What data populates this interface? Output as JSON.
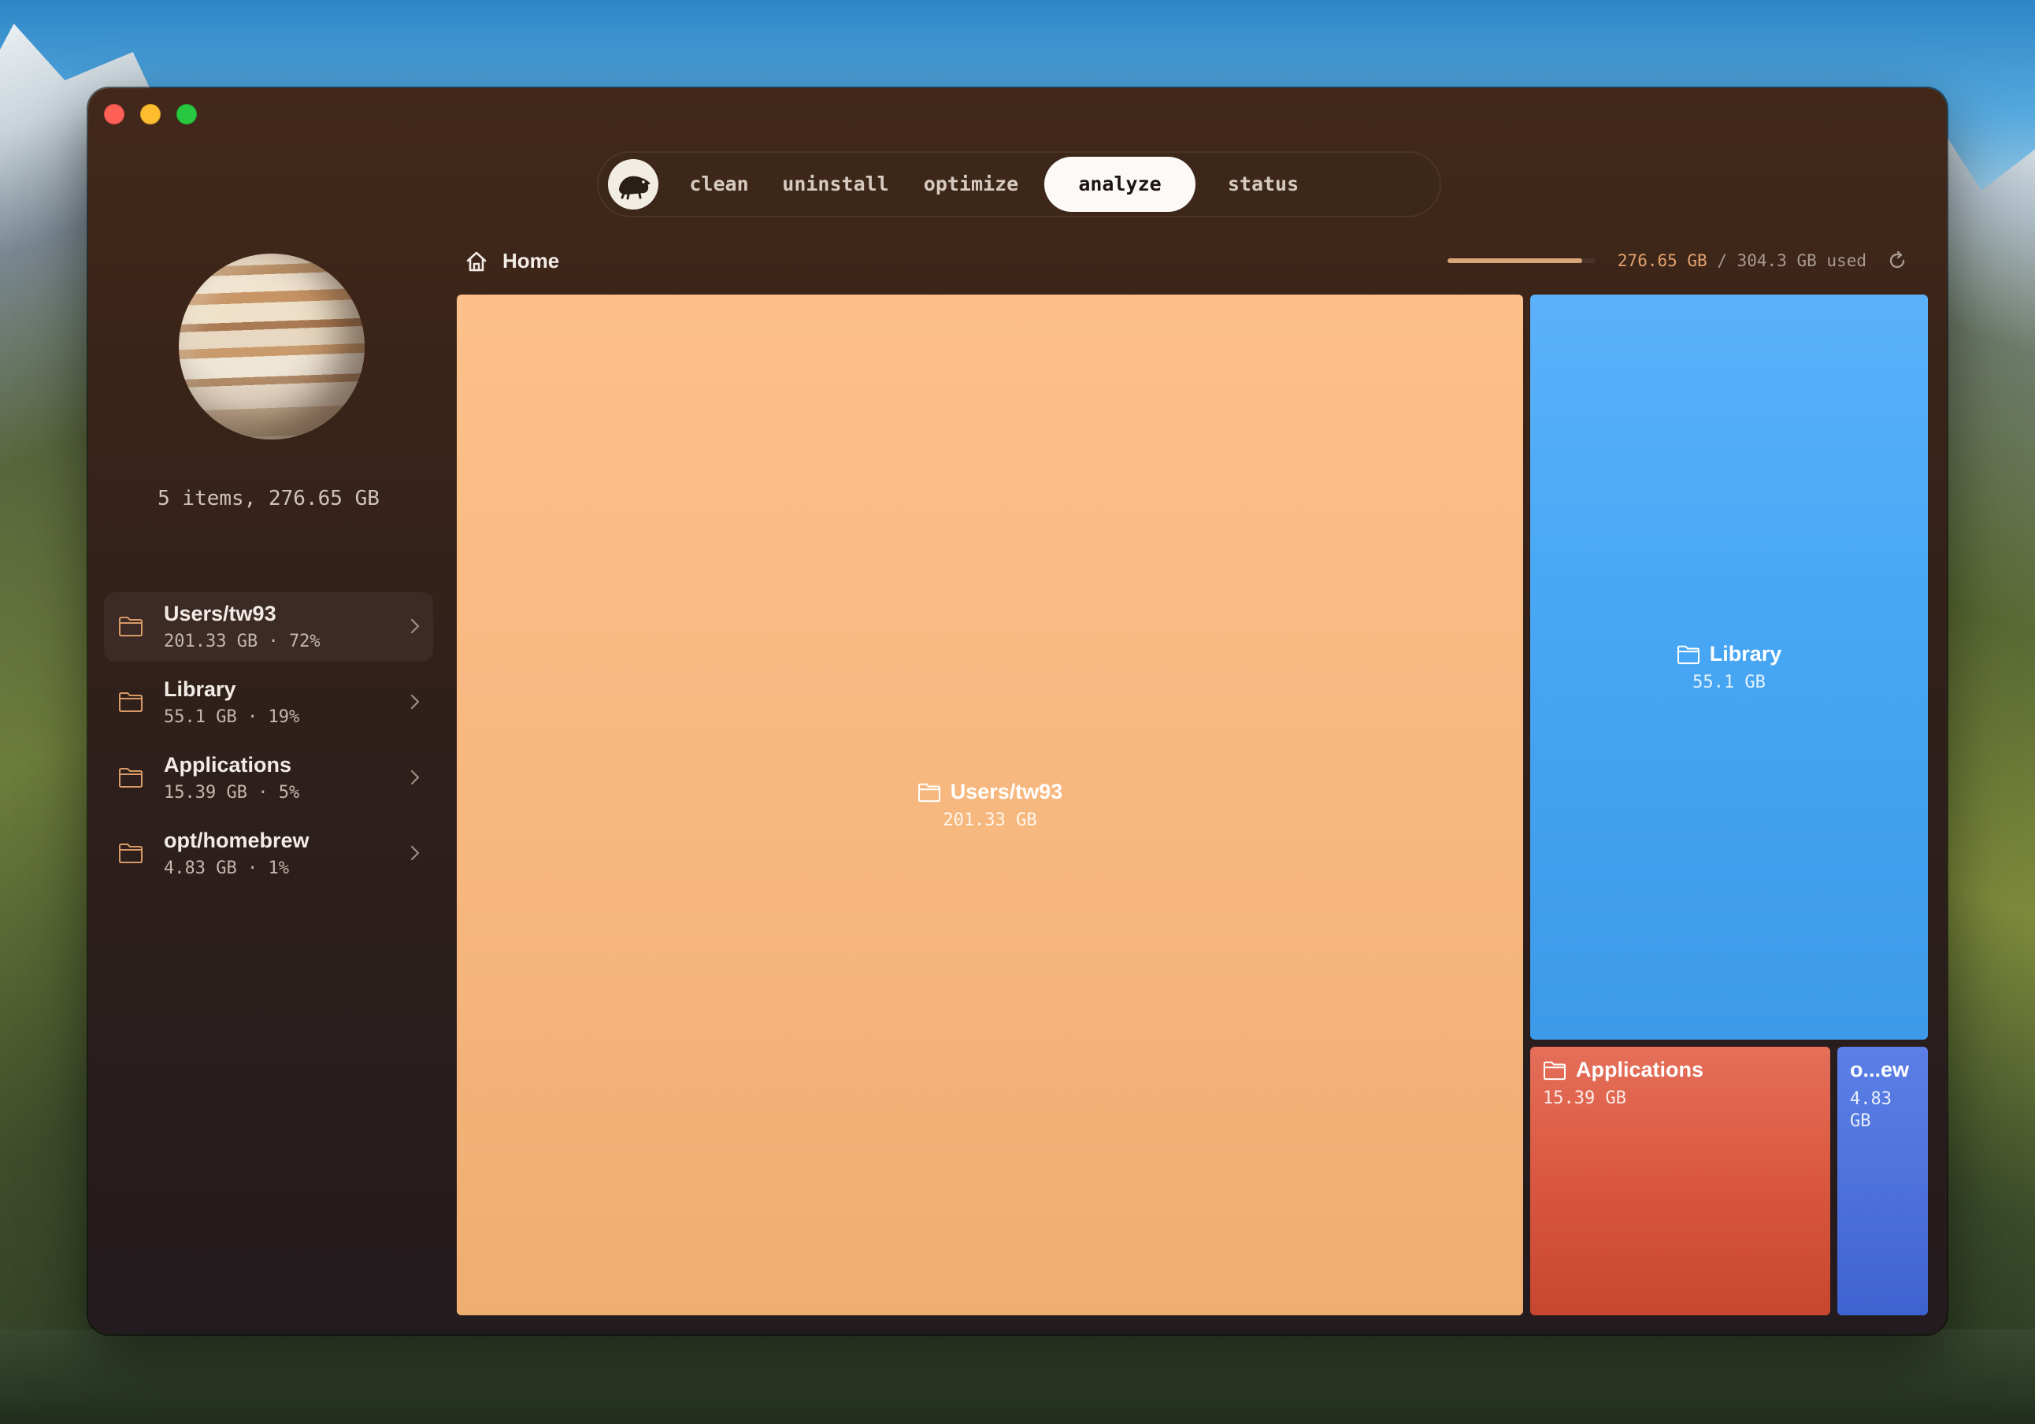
{
  "nav": {
    "tabs": [
      {
        "label": "clean",
        "active": false
      },
      {
        "label": "uninstall",
        "active": false
      },
      {
        "label": "optimize",
        "active": false
      },
      {
        "label": "analyze",
        "active": true
      },
      {
        "label": "status",
        "active": false
      }
    ]
  },
  "sidebar": {
    "summary": "5 items, 276.65 GB",
    "items": [
      {
        "name": "Users/tw93",
        "meta": "201.33 GB · 72%",
        "selected": true
      },
      {
        "name": "Library",
        "meta": "55.1 GB · 19%",
        "selected": false
      },
      {
        "name": "Applications",
        "meta": "15.39 GB · 5%",
        "selected": false
      },
      {
        "name": "opt/homebrew",
        "meta": "4.83 GB · 1%",
        "selected": false
      }
    ]
  },
  "breadcrumb": {
    "label": "Home"
  },
  "usage": {
    "used": "276.65 GB",
    "rest": " / 304.3 GB used",
    "fraction": 0.909
  },
  "treemap": {
    "tiles": [
      {
        "name": "Users/tw93",
        "size": "201.33 GB",
        "color": "#f7b87f"
      },
      {
        "name": "Library",
        "size": "55.1 GB",
        "color": "#48a8f5"
      },
      {
        "name": "Applications",
        "size": "15.39 GB",
        "color": "#d9573f"
      },
      {
        "name": "o...ew",
        "size": "4.83 GB",
        "color": "#4d72dc"
      }
    ]
  },
  "icons": {
    "logo": "mole-logo-icon",
    "folder": "folder-icon",
    "chevron": "chevron-right-icon",
    "home": "home-icon",
    "refresh": "refresh-icon"
  }
}
